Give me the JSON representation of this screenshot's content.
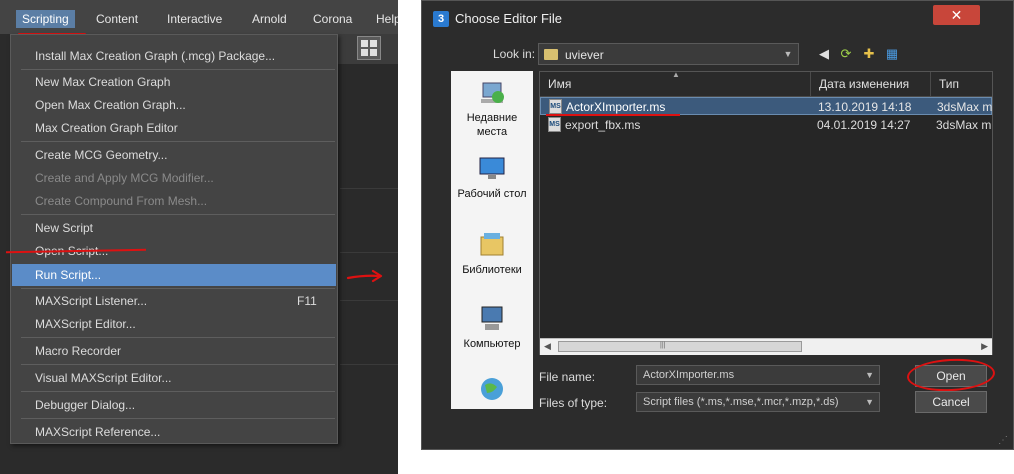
{
  "menubar": {
    "items": [
      "Scripting",
      "Content",
      "Interactive",
      "Arnold",
      "Corona",
      "Help"
    ]
  },
  "scripting_menu": {
    "items": [
      {
        "label": "Install Max Creation Graph (.mcg) Package...",
        "enabled": true
      },
      {
        "label": "New Max Creation Graph",
        "enabled": true
      },
      {
        "label": "Open Max Creation Graph...",
        "enabled": true
      },
      {
        "label": "Max Creation Graph Editor",
        "enabled": true
      },
      {
        "label": "Create MCG Geometry...",
        "enabled": true
      },
      {
        "label": "Create and Apply MCG Modifier...",
        "enabled": false
      },
      {
        "label": "Create Compound From Mesh...",
        "enabled": false
      },
      {
        "label": "New Script",
        "enabled": true
      },
      {
        "label": "Open Script...",
        "enabled": true
      },
      {
        "label": "Run Script...",
        "enabled": true,
        "highlighted": true
      },
      {
        "label": "MAXScript Listener...",
        "enabled": true,
        "shortcut": "F11"
      },
      {
        "label": "MAXScript Editor...",
        "enabled": true
      },
      {
        "label": "Macro Recorder",
        "enabled": true
      },
      {
        "label": "Visual MAXScript Editor...",
        "enabled": true
      },
      {
        "label": "Debugger Dialog...",
        "enabled": true
      },
      {
        "label": "MAXScript Reference...",
        "enabled": true
      }
    ]
  },
  "dialog": {
    "app_icon": "3",
    "title": "Choose Editor File",
    "close_symbol": "✕",
    "look_in_label": "Look in:",
    "look_in_value": "uviever",
    "nav_icons": [
      "back-arrow-icon",
      "up-folder-icon",
      "new-folder-icon",
      "view-menu-icon"
    ],
    "places": [
      "Недавние места",
      "Рабочий стол",
      "Библиотеки",
      "Компьютер"
    ],
    "columns": [
      "Имя",
      "Дата изменения",
      "Тип"
    ],
    "files": [
      {
        "name": "ActorXImporter.ms",
        "date": "13.10.2019 14:18",
        "type": "3dsMax m",
        "selected": true
      },
      {
        "name": "export_fbx.ms",
        "date": "04.01.2019 14:27",
        "type": "3dsMax m",
        "selected": false
      }
    ],
    "file_icon_text": "MS",
    "file_name_label": "File name:",
    "file_name_value": "ActorXImporter.ms",
    "file_type_label": "Files of type:",
    "file_type_value": "Script files (*.ms,*.mse,*.mcr,*.mzp,*.ds)",
    "open_button": "Open",
    "cancel_button": "Cancel"
  },
  "colors": {
    "menu_bg": "#444444",
    "menu_highlight": "#5b8cc8",
    "dialog_bg": "#2c2c2c",
    "selected_row": "#3c5a7c",
    "annotation_red": "#dd1111"
  }
}
